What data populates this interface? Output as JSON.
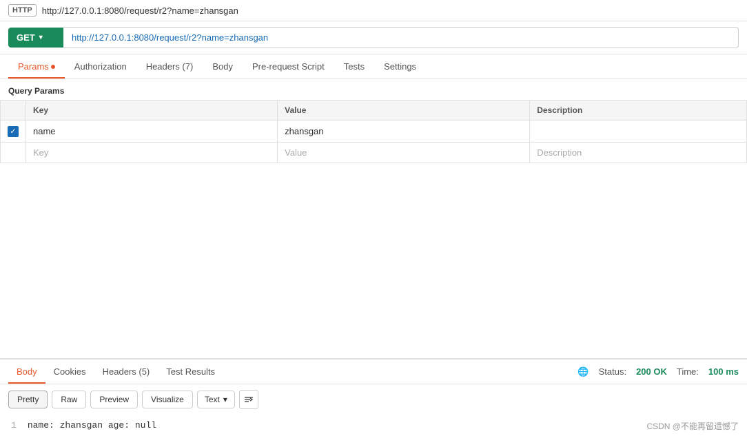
{
  "titleBar": {
    "httpBadge": "HTTP",
    "url": "http://127.0.0.1:8080/request/r2?name=zhansgan"
  },
  "requestBar": {
    "method": "GET",
    "url": "http://127.0.0.1:8080/request/r2?name=zhansgan",
    "chevron": "▾"
  },
  "tabs": [
    {
      "id": "params",
      "label": "Params",
      "hasDot": true,
      "active": true
    },
    {
      "id": "authorization",
      "label": "Authorization",
      "hasDot": false,
      "active": false
    },
    {
      "id": "headers",
      "label": "Headers (7)",
      "hasDot": false,
      "active": false
    },
    {
      "id": "body",
      "label": "Body",
      "hasDot": false,
      "active": false
    },
    {
      "id": "pre-request-script",
      "label": "Pre-request Script",
      "hasDot": false,
      "active": false
    },
    {
      "id": "tests",
      "label": "Tests",
      "hasDot": false,
      "active": false
    },
    {
      "id": "settings",
      "label": "Settings",
      "hasDot": false,
      "active": false
    }
  ],
  "queryParams": {
    "sectionLabel": "Query Params",
    "columns": [
      "Key",
      "Value",
      "Description"
    ],
    "rows": [
      {
        "checked": true,
        "key": "name",
        "value": "zhansgan",
        "description": ""
      }
    ],
    "emptyRow": {
      "key": "Key",
      "value": "Value",
      "description": "Description"
    }
  },
  "responseTabs": [
    {
      "id": "body",
      "label": "Body",
      "active": true
    },
    {
      "id": "cookies",
      "label": "Cookies",
      "active": false
    },
    {
      "id": "headers",
      "label": "Headers (5)",
      "active": false
    },
    {
      "id": "test-results",
      "label": "Test Results",
      "active": false
    }
  ],
  "statusBar": {
    "statusLabel": "Status:",
    "statusCode": "200 OK",
    "timeLabel": "Time:",
    "timeValue": "100 ms"
  },
  "responseToolbar": {
    "buttons": [
      "Pretty",
      "Raw",
      "Preview",
      "Visualize"
    ],
    "activeButton": "Pretty",
    "formatLabel": "Text",
    "chevron": "▾",
    "wrapIcon": "⇌"
  },
  "responseBody": {
    "lines": [
      {
        "num": "1",
        "content": "name: zhansgan  age: null"
      }
    ]
  },
  "watermark": {
    "text": "CSDN @不能再留遗憾了"
  }
}
